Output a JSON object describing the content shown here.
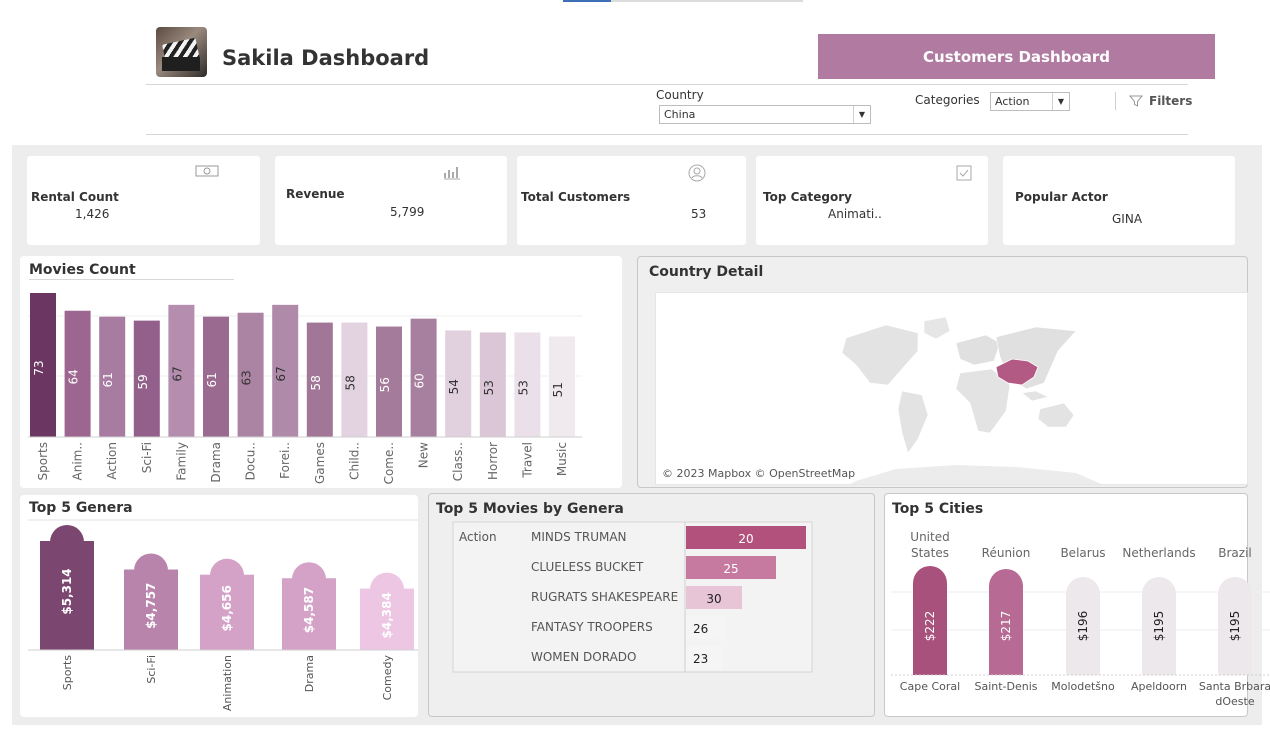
{
  "header": {
    "title": "Sakila Dashboard",
    "nav_button": "Customers Dashboard"
  },
  "filters": {
    "country_label": "Country",
    "country_value": "China",
    "categories_label": "Categories",
    "categories_value": "Action",
    "filters_label": "Filters"
  },
  "kpis": {
    "rental_count": {
      "label": "Rental Count",
      "value": "1,426",
      "icon": "money-icon"
    },
    "revenue": {
      "label": "Revenue",
      "value": "5,799",
      "icon": "bar-chart-icon"
    },
    "total_customers": {
      "label": "Total Customers",
      "value": "53",
      "icon": "user-circle-icon"
    },
    "top_category": {
      "label": "Top Category",
      "value": "Animati..",
      "icon": "checkbox-icon"
    },
    "popular_actor": {
      "label": "Popular Actor",
      "value": "GINA"
    }
  },
  "cards": {
    "movies_count": "Movies Count",
    "country_detail": "Country Detail",
    "top5_genera": "Top 5 Genera",
    "top5_movies": "Top 5 Movies by Genera",
    "top5_cities": "Top 5 Cities"
  },
  "map": {
    "attribution": "© 2023 Mapbox © OpenStreetMap",
    "highlight": "China",
    "highlight_color": "#b25a83"
  },
  "chart_data": [
    {
      "id": "movies_count",
      "type": "bar",
      "categories": [
        "Sports",
        "Anim..",
        "Action",
        "Sci-Fi",
        "Family",
        "Drama",
        "Docu..",
        "Forei..",
        "Games",
        "Child..",
        "Come..",
        "New",
        "Class..",
        "Horror",
        "Travel",
        "Music"
      ],
      "values": [
        73,
        64,
        61,
        59,
        67,
        61,
        63,
        67,
        58,
        58,
        56,
        60,
        54,
        53,
        53,
        51
      ],
      "colors": [
        "#6b3762",
        "#9c6690",
        "#a87ca0",
        "#92608a",
        "#b58dae",
        "#9a6a90",
        "#ab84a4",
        "#b08aa9",
        "#a17696",
        "#e3d3e0",
        "#a47b9b",
        "#a8809f",
        "#e1d0de",
        "#dac6d6",
        "#ebe0e9",
        "#f0eaef"
      ],
      "label_colors": [
        "#ffffff",
        "#ffffff",
        "#ffffff",
        "#ffffff",
        "#333333",
        "#ffffff",
        "#333333",
        "#333333",
        "#ffffff",
        "#333333",
        "#ffffff",
        "#ffffff",
        "#333333",
        "#333333",
        "#333333",
        "#333333"
      ]
    },
    {
      "id": "top5_genera",
      "type": "bar",
      "categories": [
        "Sports",
        "Sci-Fi",
        "Animation",
        "Drama",
        "Comedy"
      ],
      "values": [
        5314,
        4757,
        4656,
        4587,
        4384
      ],
      "labels": [
        "$5,314",
        "$4,757",
        "$4,656",
        "$4,587",
        "$4,384"
      ],
      "colors": [
        "#7b466f",
        "#b884ab",
        "#d4a2c6",
        "#d4a2c6",
        "#ecc6e2"
      ]
    },
    {
      "id": "top5_movies",
      "type": "bar",
      "category_group": "Action",
      "categories": [
        "MINDS TRUMAN",
        "CLUELESS BUCKET",
        "RUGRATS SHAKESPEARE",
        "FANTASY TROOPERS",
        "WOMEN DORADO"
      ],
      "values": [
        20,
        25,
        30,
        26,
        23
      ],
      "colors": [
        "#b2517c",
        "#c77aa0",
        "#e7c4d6",
        "#f5f5f5",
        "#f5f5f5"
      ]
    },
    {
      "id": "top5_cities",
      "type": "bar",
      "countries": [
        [
          "United",
          "States"
        ],
        [
          "Réunion"
        ],
        [
          "Belarus"
        ],
        [
          "Netherlands"
        ],
        [
          "Brazil"
        ]
      ],
      "categories": [
        [
          "Cape Coral"
        ],
        [
          "Saint-Denis"
        ],
        [
          "Molodetšno"
        ],
        [
          "Apeldoorn"
        ],
        [
          "Santa Brbara",
          "dOeste"
        ]
      ],
      "values": [
        222,
        217,
        196,
        195,
        195
      ],
      "labels": [
        "$222",
        "$217",
        "$196",
        "$195",
        "$195"
      ],
      "colors": [
        "#a8517c",
        "#b76a93",
        "#ede8ec",
        "#ede8ec",
        "#ede8ec"
      ]
    }
  ]
}
